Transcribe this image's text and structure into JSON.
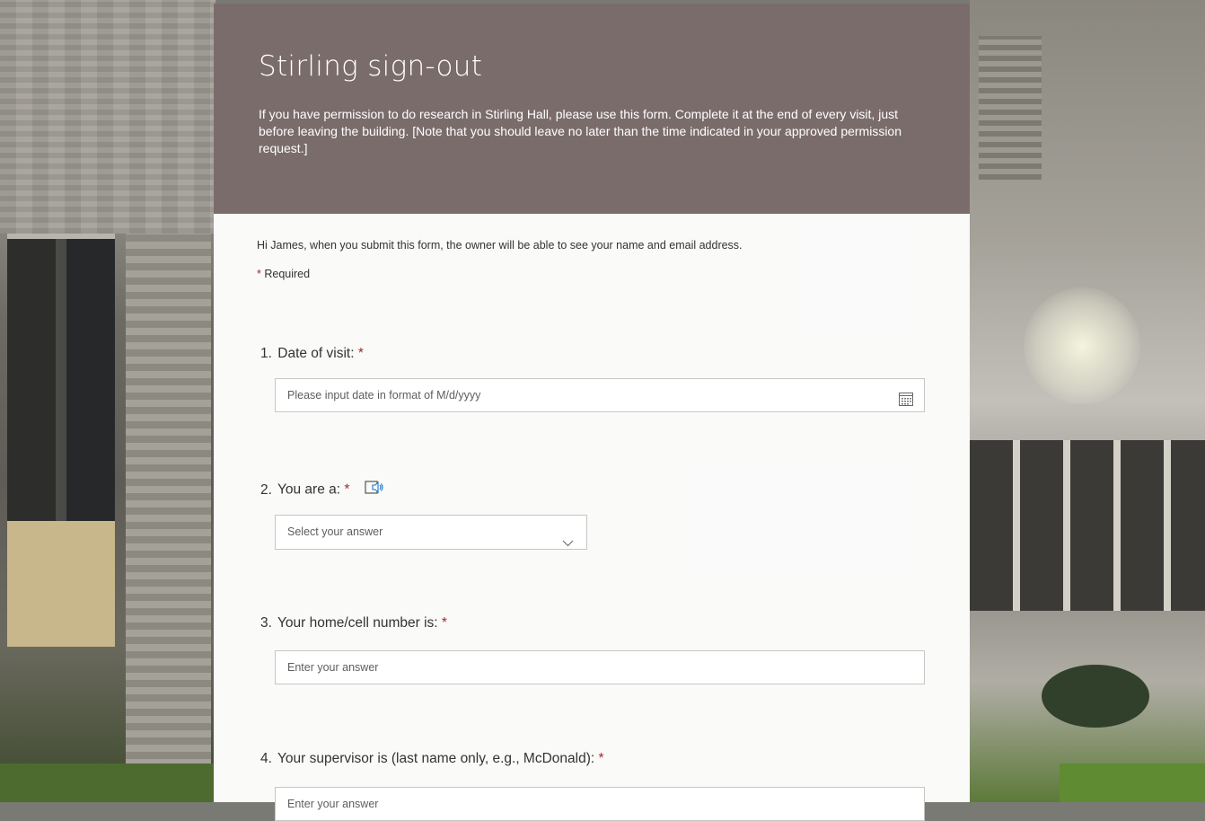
{
  "form": {
    "title": "Stirling sign-out",
    "description": "If you have permission to do research in Stirling Hall, please use this form.  Complete it at the end of every visit, just before leaving the building.  [Note that you should leave no later than the time indicated in your approved permission request.]",
    "notice": "Hi James, when you submit this form, the owner will be able to see your name and email address.",
    "required_marker": "*",
    "required_label": "Required"
  },
  "questions": [
    {
      "number": "1.",
      "label": "Date of visit:",
      "required": "*",
      "placeholder": "Please input date in format of M/d/yyyy",
      "icon": "calendar-icon"
    },
    {
      "number": "2.",
      "label": "You are a:",
      "required": "*",
      "placeholder": "Select your answer",
      "icon": "immersive-reader-icon"
    },
    {
      "number": "3.",
      "label": "Your home/cell number is:",
      "required": "*",
      "placeholder": "Enter your answer"
    },
    {
      "number": "4.",
      "label": "Your supervisor is (last name only, e.g., McDonald):",
      "required": "*",
      "placeholder": "Enter your answer"
    }
  ],
  "colors": {
    "header_bg": "#7b6c6c",
    "required_star": "#a4262c"
  }
}
